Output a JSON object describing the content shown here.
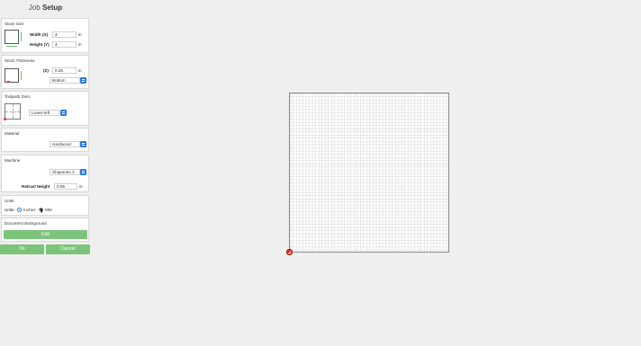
{
  "header": {
    "title_light": "Job",
    "title_bold": "Setup"
  },
  "stock_size": {
    "label": "Stock Size",
    "width_label": "Width (X)",
    "width_value": "4",
    "width_unit": "in",
    "height_label": "Height (Y)",
    "height_value": "4",
    "height_unit": "in"
  },
  "stock_thickness": {
    "label": "Stock Thickness",
    "z_label": "(Z)",
    "z_value": "0.25",
    "z_unit": "in",
    "reference_value": "Bottom"
  },
  "toolpath_zero": {
    "label": "Toolpath Zero",
    "value": "Lower-left"
  },
  "material": {
    "label": "Material",
    "value": "Hardwood"
  },
  "machine": {
    "label": "Machine",
    "value": "Shapeoko 3",
    "retract_label": "Retract Height",
    "retract_value": "0.05",
    "retract_unit": "in"
  },
  "units": {
    "label": "Units",
    "row_label": "Units:",
    "option_inches": "Inches",
    "option_mm": "MM",
    "selected": "Inches"
  },
  "document_background": {
    "label": "Document Background",
    "edit_label": "Edit"
  },
  "footer": {
    "ok_label": "Ok",
    "cancel_label": "Cancel"
  },
  "colors": {
    "accent_blue": "#2f7ad8",
    "button_green": "#7cc47a",
    "origin_red": "#e33333"
  }
}
